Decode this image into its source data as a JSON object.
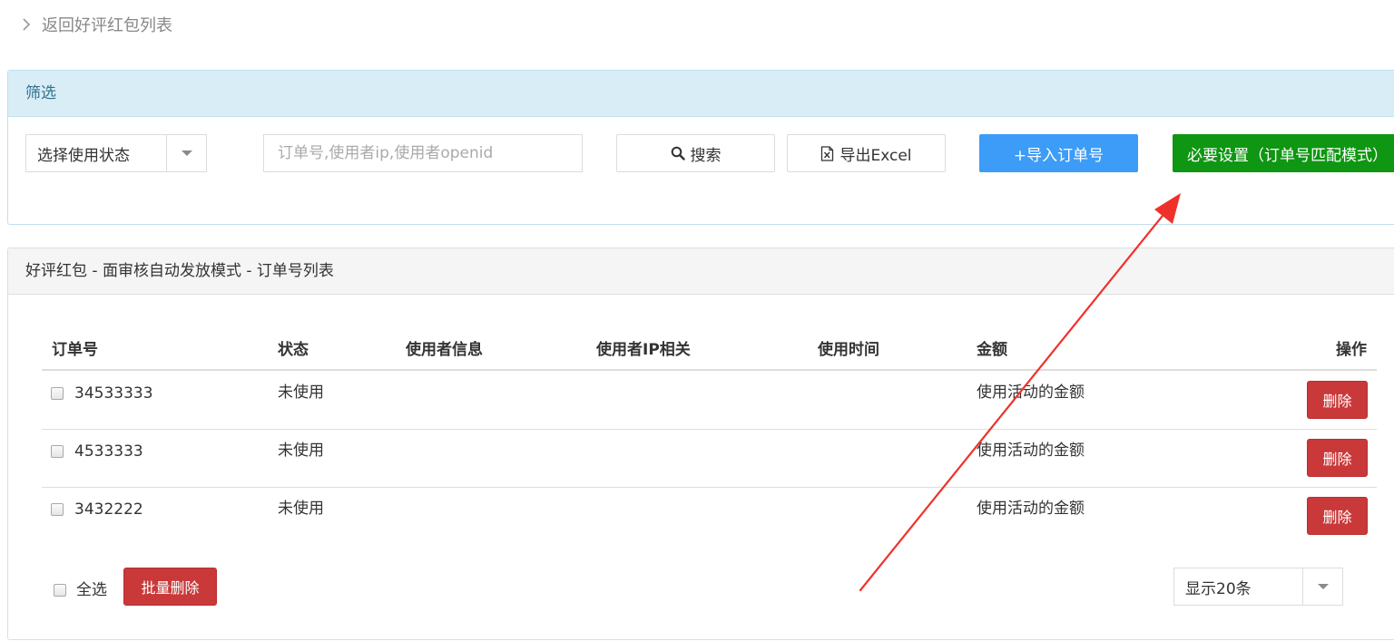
{
  "back": {
    "label": "返回好评红包列表"
  },
  "filter": {
    "title": "筛选",
    "status_select": "选择使用状态",
    "search_placeholder": "订单号,使用者ip,使用者openid",
    "search_label": "搜索",
    "export_label": "导出Excel",
    "import_label": "+导入订单号",
    "settings_label": "必要设置（订单号匹配模式）"
  },
  "list": {
    "title": "好评红包 - 面审核自动发放模式 - 订单号列表",
    "columns": [
      "订单号",
      "状态",
      "使用者信息",
      "使用者IP相关",
      "使用时间",
      "金额",
      "操作"
    ],
    "rows": [
      {
        "order": "34533333",
        "status": "未使用",
        "user_info": "",
        "ip": "",
        "time": "",
        "amount": "使用活动的金额",
        "action": "删除"
      },
      {
        "order": "4533333",
        "status": "未使用",
        "user_info": "",
        "ip": "",
        "time": "",
        "amount": "使用活动的金额",
        "action": "删除"
      },
      {
        "order": "3432222",
        "status": "未使用",
        "user_info": "",
        "ip": "",
        "time": "",
        "amount": "使用活动的金额",
        "action": "删除"
      }
    ],
    "select_all": "全选",
    "batch_delete": "批量删除",
    "page_size": "显示20条"
  },
  "colors": {
    "filter_header_bg": "#d9edf6",
    "primary_blue": "#3c9cf7",
    "success_green": "#0f9612",
    "danger_red": "#c9393a",
    "annotation_arrow": "#f0312b"
  }
}
